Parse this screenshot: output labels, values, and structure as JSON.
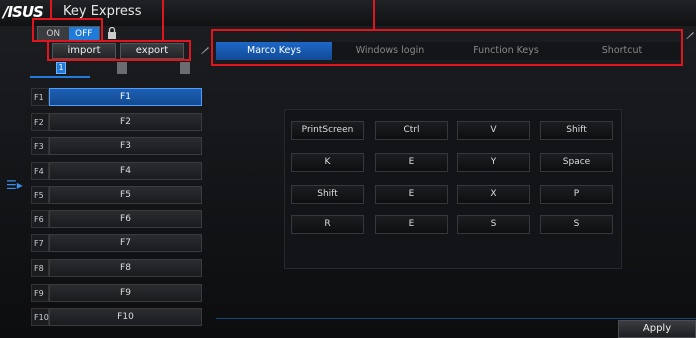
{
  "app": {
    "logo": "/ISUS",
    "title": "Key Express"
  },
  "toggle": {
    "on_label": "ON",
    "off_label": "OFF"
  },
  "toolbar": {
    "import_label": "import",
    "export_label": "export"
  },
  "left_tabs": {
    "active_label": "1"
  },
  "fkeys": [
    {
      "num": "F1",
      "name": "F1"
    },
    {
      "num": "F2",
      "name": "F2"
    },
    {
      "num": "F3",
      "name": "F3"
    },
    {
      "num": "F4",
      "name": "F4"
    },
    {
      "num": "F5",
      "name": "F5"
    },
    {
      "num": "F6",
      "name": "F6"
    },
    {
      "num": "F7",
      "name": "F7"
    },
    {
      "num": "F8",
      "name": "F8"
    },
    {
      "num": "F9",
      "name": "F9"
    },
    {
      "num": "F10",
      "name": "F10"
    }
  ],
  "main_tabs": [
    "Marco Keys",
    "Windows login",
    "Function Keys",
    "Shortcut"
  ],
  "keys": [
    [
      "PrintScreen",
      "Ctrl",
      "V",
      "Shift"
    ],
    [
      "K",
      "E",
      "Y",
      "Space"
    ],
    [
      "Shift",
      "E",
      "X",
      "P"
    ],
    [
      "R",
      "E",
      "S",
      "S"
    ]
  ],
  "apply_label": "Apply",
  "colors": {
    "accent": "#1f7ad8",
    "highlight": "#e0151d",
    "background": "#101113"
  }
}
